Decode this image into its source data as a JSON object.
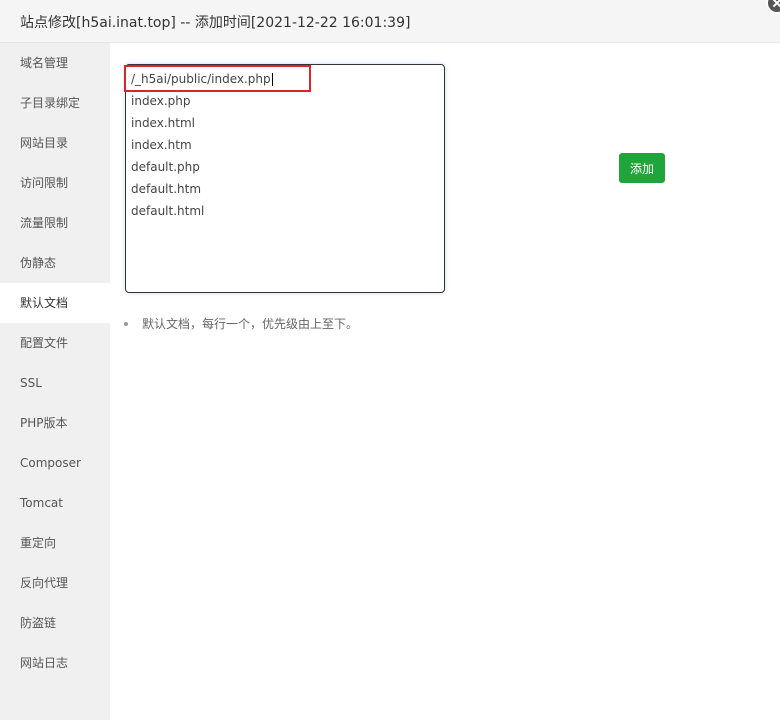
{
  "window": {
    "title": "站点修改[h5ai.inat.top] -- 添加时间[2021-12-22 16:01:39]"
  },
  "sidebar": {
    "items": [
      {
        "label": "域名管理"
      },
      {
        "label": "子目录绑定"
      },
      {
        "label": "网站目录"
      },
      {
        "label": "访问限制"
      },
      {
        "label": "流量限制"
      },
      {
        "label": "伪静态"
      },
      {
        "label": "默认文档",
        "active": true
      },
      {
        "label": "配置文件"
      },
      {
        "label": "SSL"
      },
      {
        "label": "PHP版本"
      },
      {
        "label": "Composer"
      },
      {
        "label": "Tomcat"
      },
      {
        "label": "重定向"
      },
      {
        "label": "反向代理"
      },
      {
        "label": "防盗链"
      },
      {
        "label": "网站日志"
      }
    ]
  },
  "main": {
    "default_docs": [
      "/_h5ai/public/index.php",
      "index.php",
      "index.html",
      "index.htm",
      "default.php",
      "default.htm",
      "default.html"
    ],
    "add_button_label": "添加",
    "tip": "默认文档，每行一个，优先级由上至下。"
  },
  "colors": {
    "accent_green": "#20a53a",
    "highlight_red": "#d9262c",
    "sidebar_bg": "#f0f0f0"
  }
}
